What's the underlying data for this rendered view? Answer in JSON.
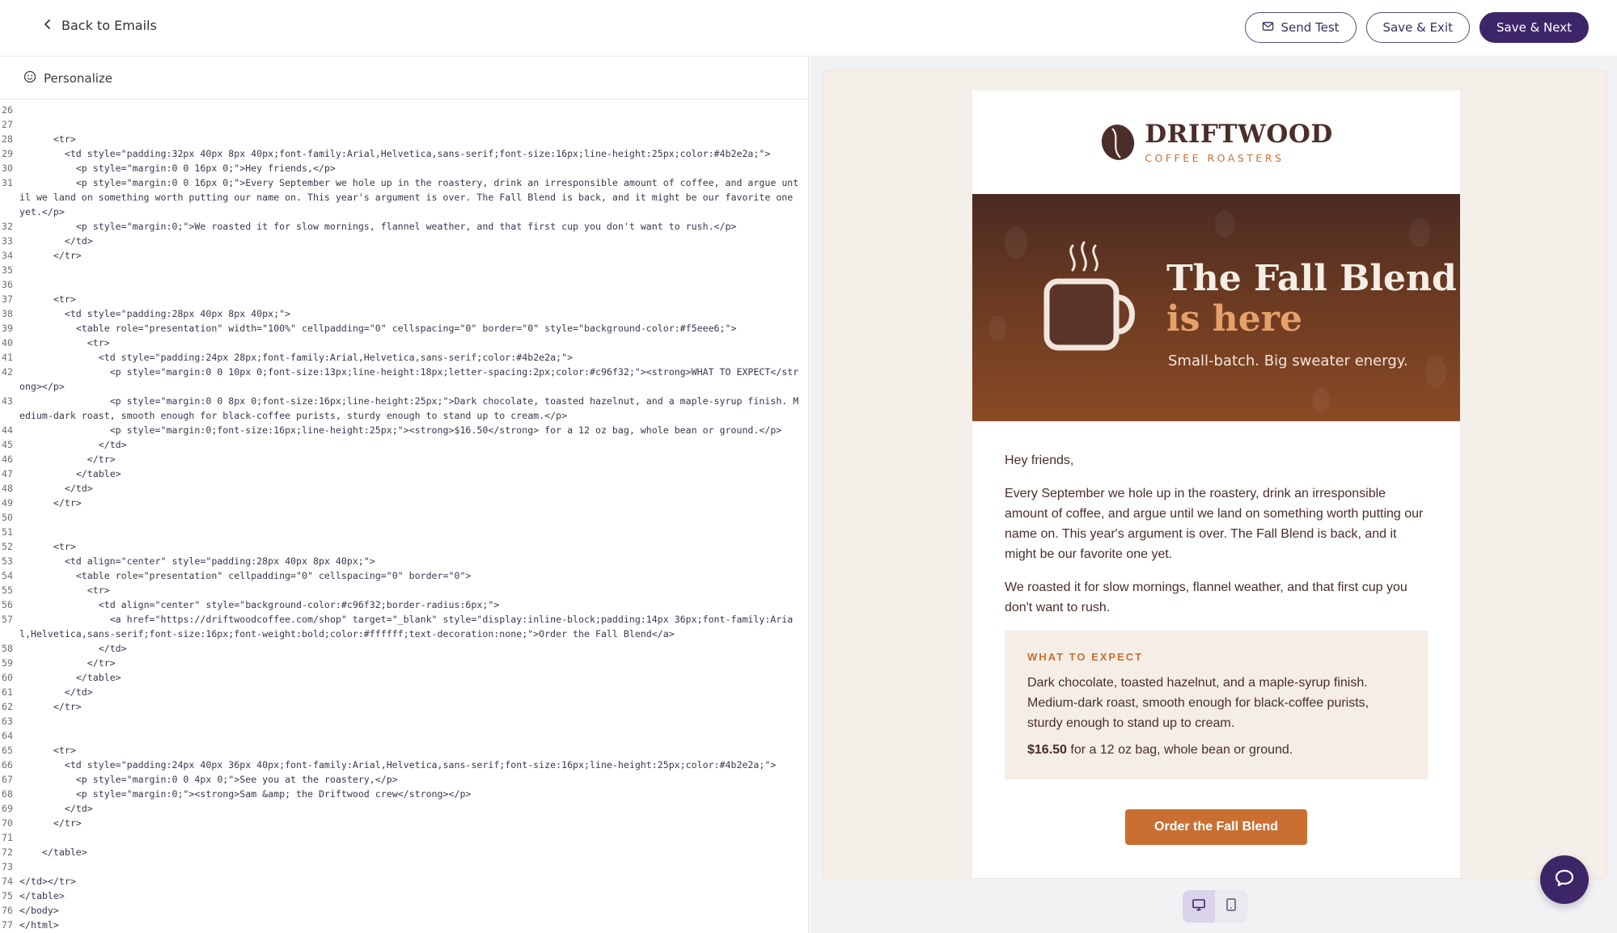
{
  "topbar": {
    "back_label": "Back to Emails",
    "send_test_label": "Send Test",
    "save_exit_label": "Save & Exit",
    "save_next_label": "Save & Next"
  },
  "editor": {
    "personalize_label": "Personalize",
    "lines": [
      {
        "n": "26",
        "t": ""
      },
      {
        "n": "27",
        "t": ""
      },
      {
        "n": "28",
        "t": "      <tr>"
      },
      {
        "n": "29",
        "t": "        <td style=\"padding:32px 40px 8px 40px;font-family:Arial,Helvetica,sans-serif;font-size:16px;line-height:25px;color:#4b2e2a;\">"
      },
      {
        "n": "30",
        "t": "          <p style=\"margin:0 0 16px 0;\">Hey friends,</p>"
      },
      {
        "n": "31",
        "t": "          <p style=\"margin:0 0 16px 0;\">Every September we hole up in the roastery, drink an irresponsible amount of coffee, and argue until we land on something worth putting our name on. This year's argument is over. The Fall Blend is back, and it might be our favorite one yet.</p>"
      },
      {
        "n": "32",
        "t": "          <p style=\"margin:0;\">We roasted it for slow mornings, flannel weather, and that first cup you don't want to rush.</p>"
      },
      {
        "n": "33",
        "t": "        </td>"
      },
      {
        "n": "34",
        "t": "      </tr>"
      },
      {
        "n": "35",
        "t": ""
      },
      {
        "n": "36",
        "t": ""
      },
      {
        "n": "37",
        "t": "      <tr>"
      },
      {
        "n": "38",
        "t": "        <td style=\"padding:28px 40px 8px 40px;\">"
      },
      {
        "n": "39",
        "t": "          <table role=\"presentation\" width=\"100%\" cellpadding=\"0\" cellspacing=\"0\" border=\"0\" style=\"background-color:#f5eee6;\">"
      },
      {
        "n": "40",
        "t": "            <tr>"
      },
      {
        "n": "41",
        "t": "              <td style=\"padding:24px 28px;font-family:Arial,Helvetica,sans-serif;color:#4b2e2a;\">"
      },
      {
        "n": "42",
        "t": "                <p style=\"margin:0 0 10px 0;font-size:13px;line-height:18px;letter-spacing:2px;color:#c96f32;\"><strong>WHAT TO EXPECT</strong></p>"
      },
      {
        "n": "43",
        "t": "                <p style=\"margin:0 0 8px 0;font-size:16px;line-height:25px;\">Dark chocolate, toasted hazelnut, and a maple-syrup finish. Medium-dark roast, smooth enough for black-coffee purists, sturdy enough to stand up to cream.</p>"
      },
      {
        "n": "44",
        "t": "                <p style=\"margin:0;font-size:16px;line-height:25px;\"><strong>$16.50</strong> for a 12 oz bag, whole bean or ground.</p>"
      },
      {
        "n": "45",
        "t": "              </td>"
      },
      {
        "n": "46",
        "t": "            </tr>"
      },
      {
        "n": "47",
        "t": "          </table>"
      },
      {
        "n": "48",
        "t": "        </td>"
      },
      {
        "n": "49",
        "t": "      </tr>"
      },
      {
        "n": "50",
        "t": ""
      },
      {
        "n": "51",
        "t": ""
      },
      {
        "n": "52",
        "t": "      <tr>"
      },
      {
        "n": "53",
        "t": "        <td align=\"center\" style=\"padding:28px 40px 8px 40px;\">"
      },
      {
        "n": "54",
        "t": "          <table role=\"presentation\" cellpadding=\"0\" cellspacing=\"0\" border=\"0\">"
      },
      {
        "n": "55",
        "t": "            <tr>"
      },
      {
        "n": "56",
        "t": "              <td align=\"center\" style=\"background-color:#c96f32;border-radius:6px;\">"
      },
      {
        "n": "57",
        "t": "                <a href=\"https://driftwoodcoffee.com/shop\" target=\"_blank\" style=\"display:inline-block;padding:14px 36px;font-family:Arial,Helvetica,sans-serif;font-size:16px;font-weight:bold;color:#ffffff;text-decoration:none;\">Order the Fall Blend</a>"
      },
      {
        "n": "58",
        "t": "              </td>"
      },
      {
        "n": "59",
        "t": "            </tr>"
      },
      {
        "n": "60",
        "t": "          </table>"
      },
      {
        "n": "61",
        "t": "        </td>"
      },
      {
        "n": "62",
        "t": "      </tr>"
      },
      {
        "n": "63",
        "t": ""
      },
      {
        "n": "64",
        "t": ""
      },
      {
        "n": "65",
        "t": "      <tr>"
      },
      {
        "n": "66",
        "t": "        <td style=\"padding:24px 40px 36px 40px;font-family:Arial,Helvetica,sans-serif;font-size:16px;line-height:25px;color:#4b2e2a;\">"
      },
      {
        "n": "67",
        "t": "          <p style=\"margin:0 0 4px 0;\">See you at the roastery,</p>"
      },
      {
        "n": "68",
        "t": "          <p style=\"margin:0;\"><strong>Sam &amp; the Driftwood crew</strong></p>"
      },
      {
        "n": "69",
        "t": "        </td>"
      },
      {
        "n": "70",
        "t": "      </tr>"
      },
      {
        "n": "71",
        "t": ""
      },
      {
        "n": "72",
        "t": "    </table>"
      },
      {
        "n": "73",
        "t": ""
      },
      {
        "n": "74",
        "t": "</td></tr>"
      },
      {
        "n": "75",
        "t": "</table>"
      },
      {
        "n": "76",
        "t": "</body>"
      },
      {
        "n": "77",
        "t": "</html>"
      }
    ]
  },
  "preview": {
    "brand_name": "DRIFTWOOD",
    "brand_sub": "COFFEE ROASTERS",
    "hero_title_1": "The Fall Blend",
    "hero_title_2": "is here",
    "hero_sub": "Small-batch. Big sweater energy.",
    "greeting": "Hey friends,",
    "para1": "Every September we hole up in the roastery, drink an irresponsible amount of coffee, and argue until we land on something worth putting our name on. This year's argument is over. The Fall Blend is back, and it might be our favorite one yet.",
    "para2": "We roasted it for slow mornings, flannel weather, and that first cup you don't want to rush.",
    "expect_head": "WHAT TO EXPECT",
    "expect_body": "Dark chocolate, toasted hazelnut, and a maple-syrup finish. Medium-dark roast, smooth enough for black-coffee purists, sturdy enough to stand up to cream.",
    "price": "$16.50",
    "price_rest": " for a 12 oz bag, whole bean or ground.",
    "cta_label": "Order the Fall Blend"
  },
  "icons": {
    "back": "chevron-left-icon",
    "send_test": "mail-icon",
    "personalize": "smiley-icon",
    "desktop": "desktop-icon",
    "mobile": "tablet-icon",
    "chat": "chat-icon"
  },
  "colors": {
    "primary": "#3d2668",
    "brand_brown": "#4b2e2a",
    "brand_orange": "#c96f32",
    "panel_bg": "#f5eee6"
  }
}
